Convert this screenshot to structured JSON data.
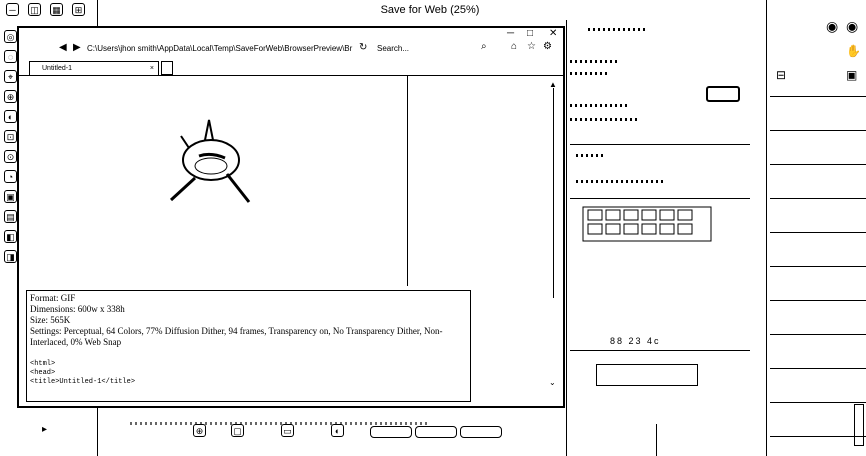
{
  "window": {
    "title": "Save for Web (25%)"
  },
  "browser": {
    "address": "C:\\Users\\jhon smith\\AppData\\Local\\Temp\\SaveForWeb\\BrowserPreview\\Br",
    "search_placeholder": "Search...",
    "tab_label": "Untitled-1"
  },
  "image_info": {
    "format": "Format: GIF",
    "dimensions": "Dimensions: 600w x 338h",
    "size": "Size: 565K",
    "settings": "Settings: Perceptual, 64 Colors, 77% Diffusion Dither, 94 frames, Transparency on, No Transparency Dither, Non-Interlaced, 0% Web Snap"
  },
  "source_code": {
    "line1": "<html>",
    "line2": "<head>",
    "line3": "<title>Untitled-1</title>"
  },
  "bottom_controls": {
    "nav_text": "88 23 4c"
  }
}
